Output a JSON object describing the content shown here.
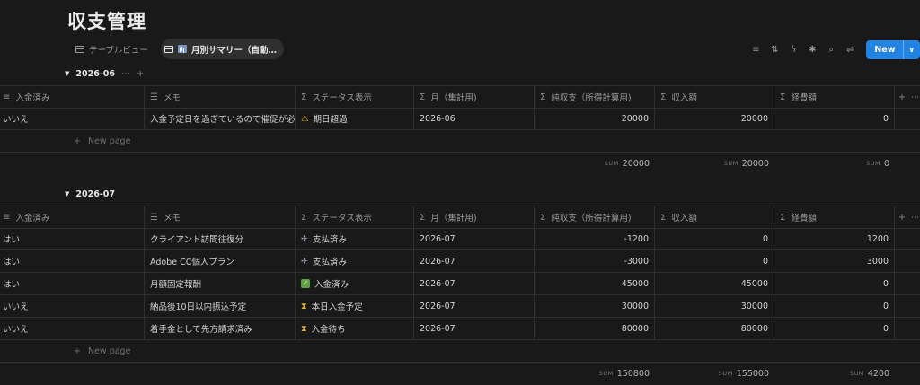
{
  "page": {
    "title": "収支管理"
  },
  "views": [
    {
      "label": "テーブルビュー",
      "icon": "table-icon"
    },
    {
      "label": "月別サマリー（自動…",
      "icon": "bar-chart-icon",
      "active": true
    }
  ],
  "toolbar": {
    "new_label": "New"
  },
  "columns": [
    {
      "label": "入金済み",
      "icon": "list-icon"
    },
    {
      "label": "メモ",
      "icon": "text-icon"
    },
    {
      "label": "ステータス表示",
      "icon": "sigma-icon"
    },
    {
      "label": "月（集計用)",
      "icon": "sigma-icon"
    },
    {
      "label": "純収支（所得計算用)",
      "icon": "sigma-icon"
    },
    {
      "label": "収入額",
      "icon": "sigma-icon"
    },
    {
      "label": "経費額",
      "icon": "sigma-icon"
    }
  ],
  "new_page_label": "New page",
  "sum_label": "SUM",
  "colors": {
    "accent": "#2383e2",
    "background": "#191919",
    "check_green": "#5fa042"
  },
  "groups": [
    {
      "name": "2026-06",
      "rows": [
        {
          "paid": "いいえ",
          "memo": "入金予定日を過ぎているので催促が必要",
          "status_icon": "warning-icon",
          "status": "期日超過",
          "month": "2026-06",
          "net": "20000",
          "income": "20000",
          "expense": "0"
        }
      ],
      "sums": {
        "net": "20000",
        "income": "20000",
        "expense": "0"
      }
    },
    {
      "name": "2026-07",
      "rows": [
        {
          "paid": "はい",
          "memo": "クライアント訪問往復分",
          "status_icon": "money-wings-icon",
          "status": "支払済み",
          "month": "2026-07",
          "net": "-1200",
          "income": "0",
          "expense": "1200"
        },
        {
          "paid": "はい",
          "memo": "Adobe CC個人プラン",
          "status_icon": "money-wings-icon",
          "status": "支払済み",
          "month": "2026-07",
          "net": "-3000",
          "income": "0",
          "expense": "3000"
        },
        {
          "paid": "はい",
          "memo": "月額固定報酬",
          "status_icon": "check-icon",
          "status": "入金済み",
          "month": "2026-07",
          "net": "45000",
          "income": "45000",
          "expense": "0"
        },
        {
          "paid": "いいえ",
          "memo": "納品後10日以内振込予定",
          "status_icon": "hourglass-icon",
          "status": "本日入金予定",
          "month": "2026-07",
          "net": "30000",
          "income": "30000",
          "expense": "0"
        },
        {
          "paid": "いいえ",
          "memo": "着手金として先方請求済み",
          "status_icon": "hourglass-icon",
          "status": "入金待ち",
          "month": "2026-07",
          "net": "80000",
          "income": "80000",
          "expense": "0"
        }
      ],
      "sums": {
        "net": "150800",
        "income": "155000",
        "expense": "4200"
      }
    }
  ]
}
